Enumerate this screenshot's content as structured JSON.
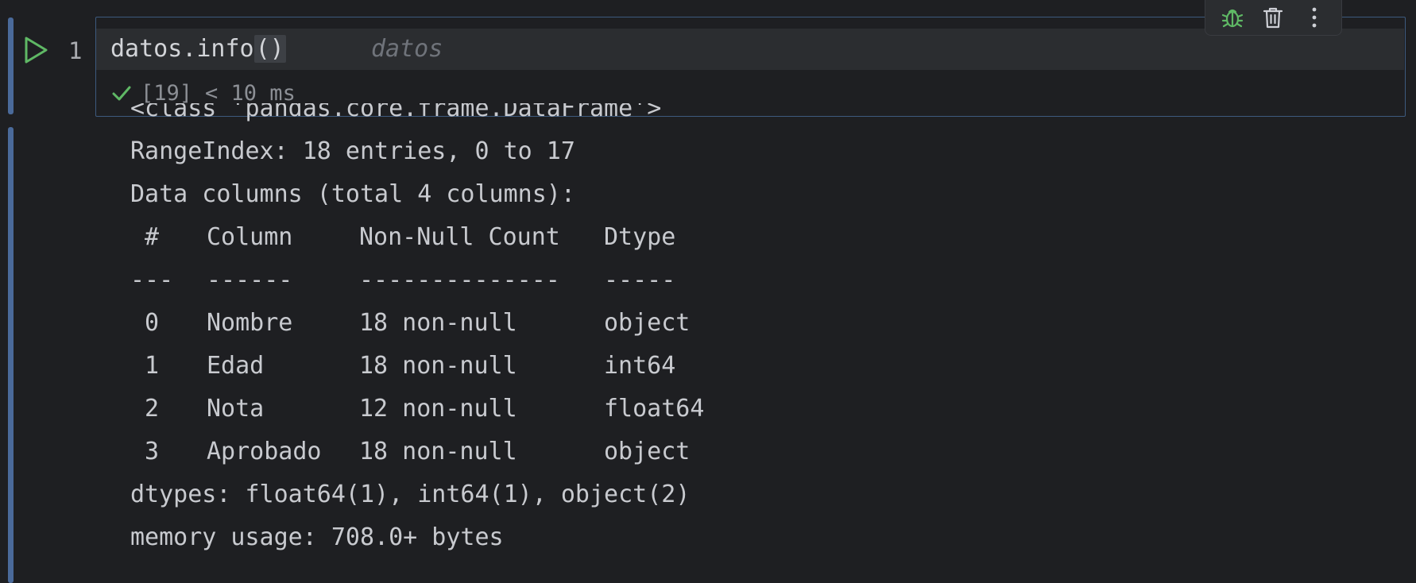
{
  "cell": {
    "line_number": "1",
    "code_call": "datos.info",
    "code_parens": "()",
    "inline_hint": "datos",
    "exec_count": "[19]",
    "exec_time": "< 10 ms"
  },
  "toolbar": {
    "icons": [
      "bug-icon",
      "trash-icon",
      "more-vertical-icon"
    ]
  },
  "output": {
    "class_line": "<class 'pandas.core.frame.DataFrame'>",
    "range_index": "RangeIndex: 18 entries, 0 to 17",
    "data_columns": "Data columns (total 4 columns):",
    "header": {
      "idx": "#",
      "column": "Column",
      "non_null": "Non-Null Count",
      "dtype": "Dtype"
    },
    "separator": {
      "idx": "---",
      "column": "------",
      "non_null": "--------------",
      "dtype": "-----"
    },
    "rows": [
      {
        "idx": "0",
        "column": "Nombre",
        "non_null": "18 non-null",
        "dtype": "object"
      },
      {
        "idx": "1",
        "column": "Edad",
        "non_null": "18 non-null",
        "dtype": "int64"
      },
      {
        "idx": "2",
        "column": "Nota",
        "non_null": "12 non-null",
        "dtype": "float64"
      },
      {
        "idx": "3",
        "column": "Aprobado",
        "non_null": "18 non-null",
        "dtype": "object"
      }
    ],
    "dtypes": "dtypes: float64(1), int64(1), object(2)",
    "memory": "memory usage: 708.0+ bytes"
  },
  "colors": {
    "background": "#1e1f22",
    "accent": "#4a6a9a",
    "success": "#5fb865",
    "run": "#5fb865"
  }
}
